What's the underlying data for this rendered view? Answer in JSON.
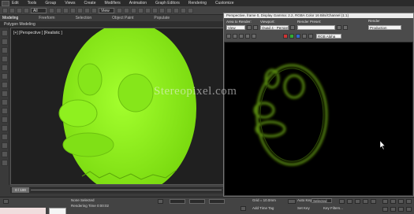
{
  "menu": [
    "Edit",
    "Tools",
    "Group",
    "Views",
    "Create",
    "Modifiers",
    "Animation",
    "Graph Editors",
    "Rendering",
    "Customize"
  ],
  "toolbar": {
    "selection_filter": "All",
    "ref_coord": "View"
  },
  "ribbon": {
    "tabs": [
      "Modeling",
      "Freeform",
      "Selection",
      "Object Paint",
      "Populate"
    ],
    "active": "Modeling",
    "panel_label": "Polygon Modeling"
  },
  "viewport": {
    "label": "[+] [Perspective ] [Realistic ]",
    "object_color": "#8cf018"
  },
  "watermark": "Stereopixel.com",
  "render_window": {
    "title": "Perspective, frame 0, Display Gamma: 2.2, RGBA Color 16 Bits/Channel (1:1)",
    "area_to_render_label": "Area to Render:",
    "area_to_render_value": "View",
    "viewport_label": "Viewport:",
    "viewport_value": "Quad 4 - Perspec",
    "render_preset_label": "Render Preset:",
    "render_preset_value": "",
    "render_button_label": "Render",
    "production_value": "Production",
    "channel_value": "RGB Alpha",
    "glow_color": "#5a8c10"
  },
  "timeline": {
    "slider_label": "0 / 100"
  },
  "status": {
    "none_selected": "None Selected",
    "rendering_time": "Rendering Time 0:00:02",
    "grid": "Grid = 10.0mm",
    "auto_key": "Auto Key",
    "selected": "Selected",
    "set_key": "Set Key",
    "key_filters": "Key Filters...",
    "add_time_tag": "Add Time Tag"
  }
}
